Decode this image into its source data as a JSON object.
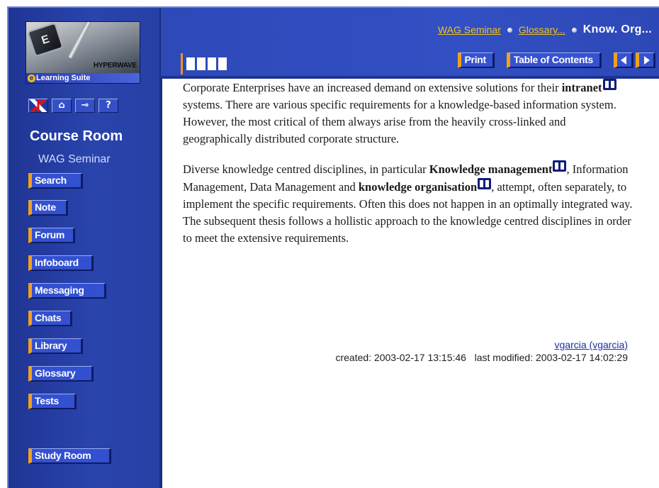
{
  "sidebar": {
    "logo": {
      "brand": "HYPERWAVE",
      "suite": "Learning Suite",
      "key_letter": "E"
    },
    "util_icons": [
      {
        "name": "language-flag-icon",
        "glyph": ""
      },
      {
        "name": "home-icon",
        "glyph": "⌂"
      },
      {
        "name": "logout-key-icon",
        "glyph": "⊸"
      },
      {
        "name": "help-icon",
        "glyph": "?"
      }
    ],
    "title": "Course Room",
    "subtitle": "WAG Seminar",
    "nav": [
      {
        "label": "Search"
      },
      {
        "label": "Note"
      },
      {
        "label": "Forum"
      },
      {
        "label": "Infoboard"
      },
      {
        "label": "Messaging"
      },
      {
        "label": "Chats"
      },
      {
        "label": "Library"
      },
      {
        "label": "Glossary"
      },
      {
        "label": "Tests"
      },
      {
        "label": "Study Room"
      }
    ]
  },
  "header": {
    "breadcrumb": {
      "link1": "WAG Seminar",
      "link2": "Glossary...",
      "current": "Know. Org..."
    },
    "toolbar": {
      "print": "Print",
      "toc": "Table of Contents"
    }
  },
  "content": {
    "p1": {
      "a": "Corporate Enterprises have an increased demand on extensive solutions for their ",
      "term1": "intranet",
      "b": " systems. There are various specific requirements for a knowledge-based information system. However, the most critical of them always arise from the heavily cross-linked and geographically distributed corporate structure."
    },
    "p2": {
      "a": "Diverse knowledge centred disciplines, in particular ",
      "term1": "Knowledge management",
      "b": ", Information Management, Data Management and ",
      "term2": "knowledge organisation",
      "c": ", attempt, often separately, to implement the specific requirements. Often this does not happen in an optimally integrated way. The subsequent thesis follows a hollistic approach to the knowledge centred disciplines in order to meet the extensive requirements."
    },
    "meta": {
      "author": "vgarcia (vgarcia)",
      "created": "created: 2003-02-17 13:15:46",
      "modified": "last modified: 2003-02-17 14:02:29"
    }
  },
  "colors": {
    "panel_blue": "#2a44ad",
    "accent_orange": "#f0a11c",
    "link_gold": "#f2c31a",
    "link_blue": "#1c2ea3"
  }
}
